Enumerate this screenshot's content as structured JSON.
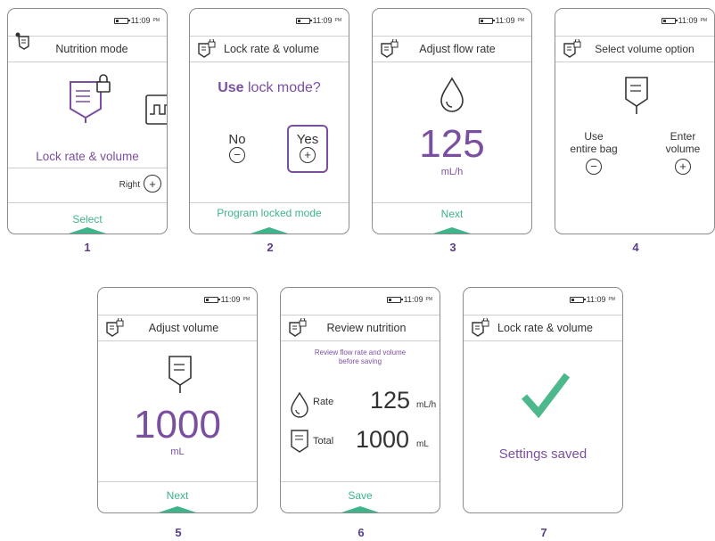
{
  "status": {
    "time": "11:09",
    "ampm": "PM"
  },
  "screens": [
    {
      "number": "1",
      "title": "Nutrition mode",
      "mode_label": "Lock rate & volume",
      "right_label": "Right",
      "footer": "Select"
    },
    {
      "number": "2",
      "title": "Lock rate & volume",
      "question_bold": "Use",
      "question_rest": " lock mode?",
      "no_label": "No",
      "yes_label": "Yes",
      "footer": "Program locked mode"
    },
    {
      "number": "3",
      "title": "Adjust flow rate",
      "value": "125",
      "unit": "mL/h",
      "footer": "Next"
    },
    {
      "number": "4",
      "title": "Select volume option",
      "opt1_line1": "Use",
      "opt1_line2": "entire bag",
      "opt2_line1": "Enter",
      "opt2_line2": "volume"
    },
    {
      "number": "5",
      "title": "Adjust volume",
      "value": "1000",
      "unit": "mL",
      "footer": "Next"
    },
    {
      "number": "6",
      "title": "Review nutrition",
      "note_line1": "Review flow rate and volume",
      "note_line2": "before saving",
      "rate_label": "Rate",
      "rate_value": "125",
      "rate_unit": "mL/h",
      "total_label": "Total",
      "total_value": "1000",
      "total_unit": "mL",
      "footer": "Save"
    },
    {
      "number": "7",
      "title": "Lock rate & volume",
      "message": "Settings saved"
    }
  ],
  "colors": {
    "accent_purple": "#7b4fa0",
    "accent_green": "#3fb38a",
    "check_green": "#4cb88c"
  }
}
